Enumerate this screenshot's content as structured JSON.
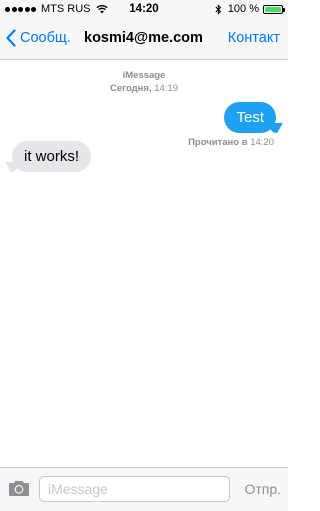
{
  "status_bar": {
    "carrier": "MTS RUS",
    "time": "14:20",
    "battery_percent": "100 %",
    "battery_level": 1.0,
    "signal_bars": 5,
    "icons": [
      "signal-dots-icon",
      "wifi-icon",
      "bluetooth-icon",
      "battery-icon"
    ]
  },
  "nav": {
    "back_label": "Сообщ.",
    "title": "kosmi4@me.com",
    "contact_label": "Контакт",
    "accent_color": "#007aff"
  },
  "conversation": {
    "service": "iMessage",
    "date_day": "Сегодня,",
    "date_time": "14:19",
    "messages": [
      {
        "direction": "outgoing",
        "text": "Test",
        "color": "#1ea1f3"
      },
      {
        "direction": "incoming",
        "text": "it works!",
        "color": "#e5e5ea"
      }
    ],
    "read_receipt_label": "Прочитано в",
    "read_receipt_time": "14:20"
  },
  "input_bar": {
    "placeholder": "iMessage",
    "value": "",
    "send_label": "Отпр.",
    "camera_icon": "camera-icon"
  }
}
